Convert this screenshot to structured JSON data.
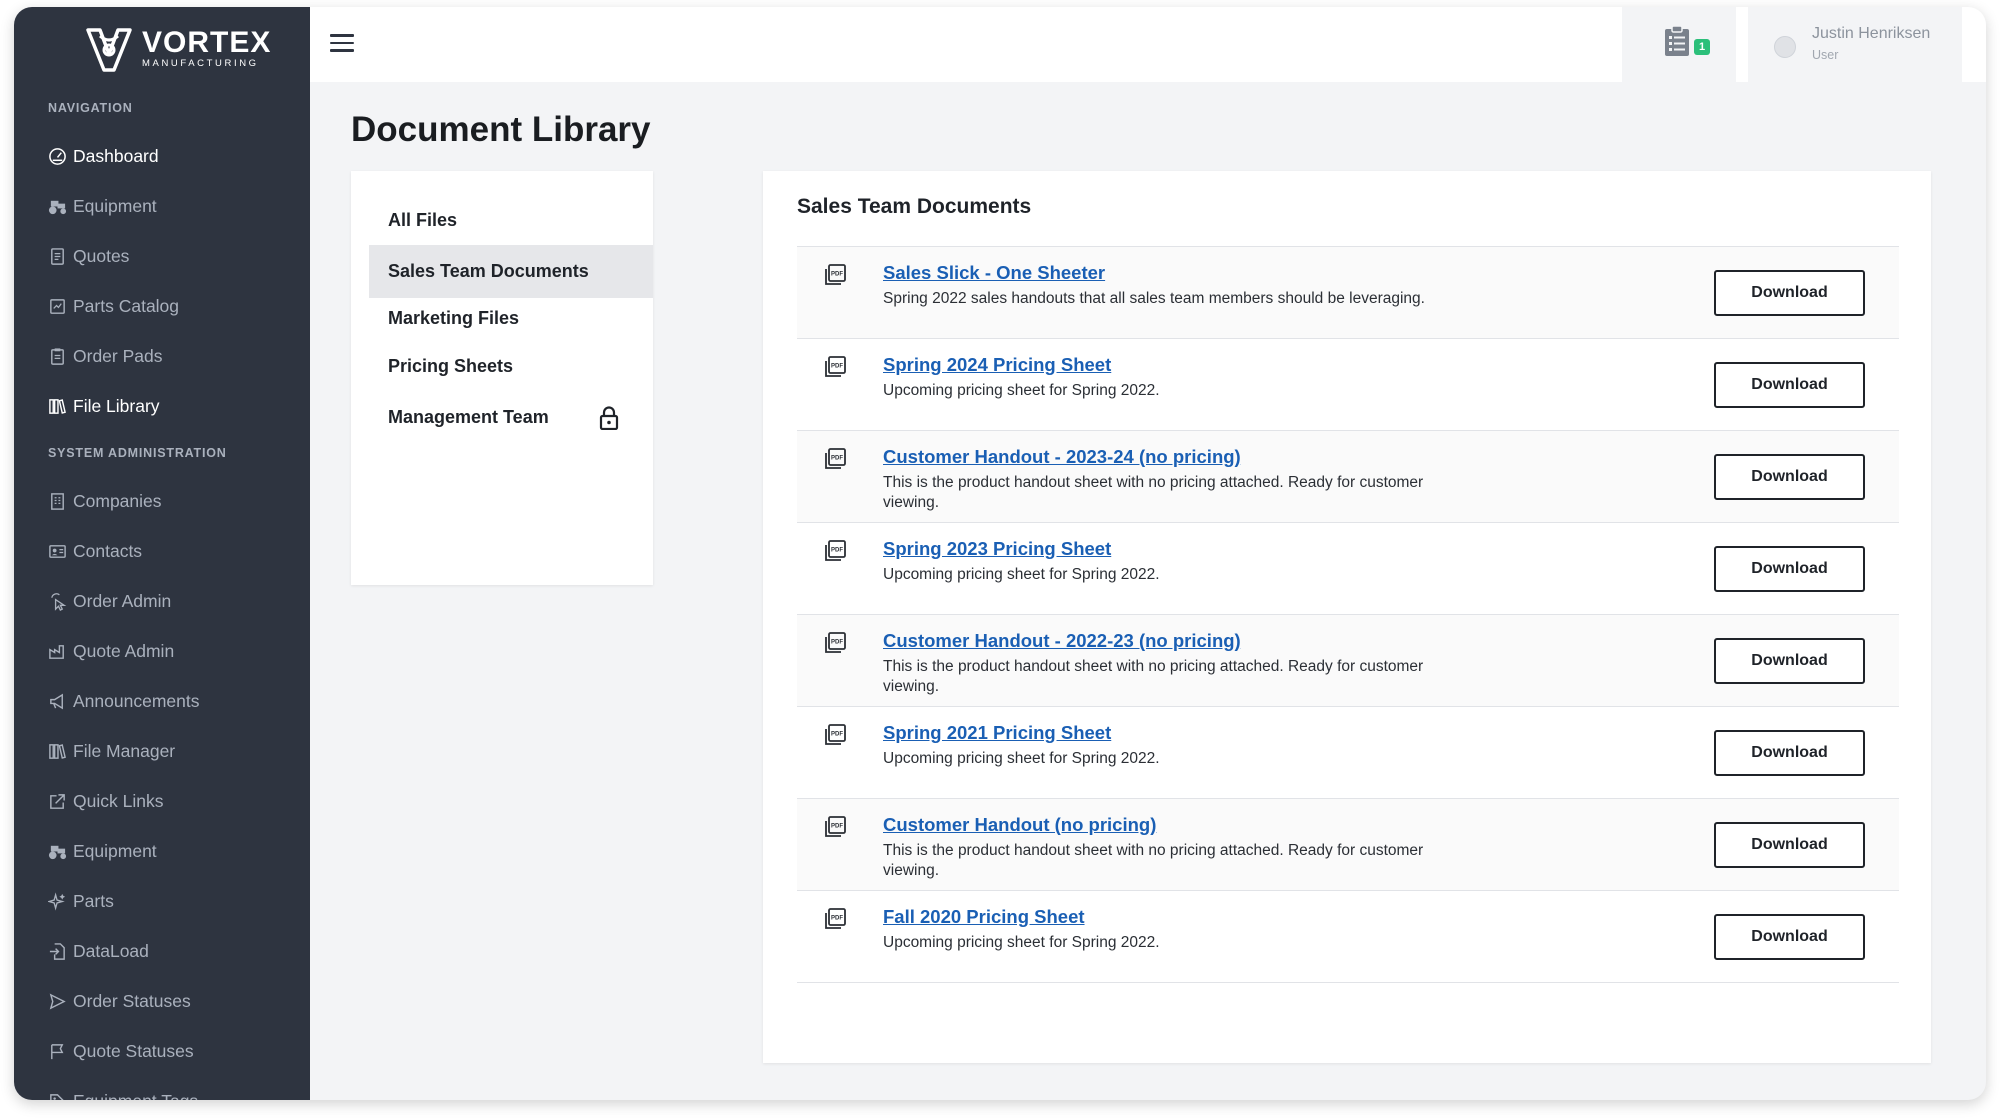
{
  "brand": {
    "name": "VORTEX",
    "tagline": "MANUFACTURING"
  },
  "sidebar": {
    "navigation_label": "NAVIGATION",
    "nav_items": [
      {
        "label": "Dashboard",
        "icon": "gauge-icon",
        "active": true
      },
      {
        "label": "Equipment",
        "icon": "tractor-icon"
      },
      {
        "label": "Quotes",
        "icon": "document-icon"
      },
      {
        "label": "Parts Catalog",
        "icon": "catalog-icon"
      },
      {
        "label": "Order Pads",
        "icon": "clipboard-icon"
      },
      {
        "label": "File Library",
        "icon": "books-icon",
        "active": true
      }
    ],
    "admin_label": "SYSTEM ADMINISTRATION",
    "admin_items": [
      {
        "label": "Companies",
        "icon": "building-icon"
      },
      {
        "label": "Contacts",
        "icon": "contact-card-icon"
      },
      {
        "label": "Order Admin",
        "icon": "pointer-icon"
      },
      {
        "label": "Quote Admin",
        "icon": "factory-icon"
      },
      {
        "label": "Announcements",
        "icon": "megaphone-icon"
      },
      {
        "label": "File Manager",
        "icon": "books-icon"
      },
      {
        "label": "Quick Links",
        "icon": "external-link-icon"
      },
      {
        "label": "Equipment",
        "icon": "tractor-icon"
      },
      {
        "label": "Parts",
        "icon": "sparkle-icon"
      },
      {
        "label": "DataLoad",
        "icon": "file-import-icon"
      },
      {
        "label": "Order Statuses",
        "icon": "send-icon"
      },
      {
        "label": "Quote Statuses",
        "icon": "flag-icon"
      },
      {
        "label": "Equipment Tags",
        "icon": "tag-icon"
      }
    ]
  },
  "topbar": {
    "notification_count": "1",
    "user_name": "Justin Henriksen",
    "user_role": "User"
  },
  "page": {
    "title": "Document Library"
  },
  "folders": [
    {
      "label": "All Files"
    },
    {
      "label": "Sales Team Documents",
      "selected": true
    },
    {
      "label": "Marketing Files"
    },
    {
      "label": "Pricing Sheets"
    },
    {
      "label": "Management Team",
      "locked": true
    }
  ],
  "documents": {
    "title": "Sales Team Documents",
    "download_label": "Download",
    "items": [
      {
        "name": "Sales Slick - One Sheeter",
        "description": "Spring 2022 sales handouts that all sales team members should be leveraging."
      },
      {
        "name": "Spring 2024 Pricing Sheet",
        "description": "Upcoming pricing sheet for Spring 2022."
      },
      {
        "name": "Customer Handout - 2023-24 (no pricing)",
        "description": "This is the product handout sheet with no pricing attached. Ready for customer viewing."
      },
      {
        "name": "Spring 2023 Pricing Sheet",
        "description": "Upcoming pricing sheet for Spring 2022."
      },
      {
        "name": "Customer Handout - 2022-23 (no pricing)",
        "description": "This is the product handout sheet with no pricing attached. Ready for customer viewing."
      },
      {
        "name": "Spring 2021 Pricing Sheet",
        "description": "Upcoming pricing sheet for Spring 2022."
      },
      {
        "name": "Customer Handout (no pricing)",
        "description": "This is the product handout sheet with no pricing attached. Ready for customer viewing."
      },
      {
        "name": "Fall 2020 Pricing Sheet",
        "description": "Upcoming pricing sheet for Spring 2022."
      }
    ]
  },
  "colors": {
    "sidebar_bg": "#2e3440",
    "link": "#1a5fb4",
    "badge": "#2bbf7a",
    "page_bg": "#f3f4f6"
  }
}
